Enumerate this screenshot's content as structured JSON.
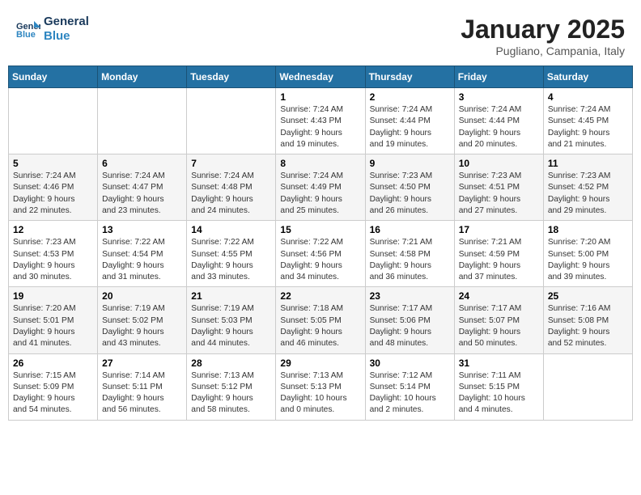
{
  "logo": {
    "line1": "General",
    "line2": "Blue"
  },
  "header": {
    "month": "January 2025",
    "location": "Pugliano, Campania, Italy"
  },
  "days_of_week": [
    "Sunday",
    "Monday",
    "Tuesday",
    "Wednesday",
    "Thursday",
    "Friday",
    "Saturday"
  ],
  "weeks": [
    [
      {
        "day": "",
        "info": ""
      },
      {
        "day": "",
        "info": ""
      },
      {
        "day": "",
        "info": ""
      },
      {
        "day": "1",
        "info": "Sunrise: 7:24 AM\nSunset: 4:43 PM\nDaylight: 9 hours\nand 19 minutes."
      },
      {
        "day": "2",
        "info": "Sunrise: 7:24 AM\nSunset: 4:44 PM\nDaylight: 9 hours\nand 19 minutes."
      },
      {
        "day": "3",
        "info": "Sunrise: 7:24 AM\nSunset: 4:44 PM\nDaylight: 9 hours\nand 20 minutes."
      },
      {
        "day": "4",
        "info": "Sunrise: 7:24 AM\nSunset: 4:45 PM\nDaylight: 9 hours\nand 21 minutes."
      }
    ],
    [
      {
        "day": "5",
        "info": "Sunrise: 7:24 AM\nSunset: 4:46 PM\nDaylight: 9 hours\nand 22 minutes."
      },
      {
        "day": "6",
        "info": "Sunrise: 7:24 AM\nSunset: 4:47 PM\nDaylight: 9 hours\nand 23 minutes."
      },
      {
        "day": "7",
        "info": "Sunrise: 7:24 AM\nSunset: 4:48 PM\nDaylight: 9 hours\nand 24 minutes."
      },
      {
        "day": "8",
        "info": "Sunrise: 7:24 AM\nSunset: 4:49 PM\nDaylight: 9 hours\nand 25 minutes."
      },
      {
        "day": "9",
        "info": "Sunrise: 7:23 AM\nSunset: 4:50 PM\nDaylight: 9 hours\nand 26 minutes."
      },
      {
        "day": "10",
        "info": "Sunrise: 7:23 AM\nSunset: 4:51 PM\nDaylight: 9 hours\nand 27 minutes."
      },
      {
        "day": "11",
        "info": "Sunrise: 7:23 AM\nSunset: 4:52 PM\nDaylight: 9 hours\nand 29 minutes."
      }
    ],
    [
      {
        "day": "12",
        "info": "Sunrise: 7:23 AM\nSunset: 4:53 PM\nDaylight: 9 hours\nand 30 minutes."
      },
      {
        "day": "13",
        "info": "Sunrise: 7:22 AM\nSunset: 4:54 PM\nDaylight: 9 hours\nand 31 minutes."
      },
      {
        "day": "14",
        "info": "Sunrise: 7:22 AM\nSunset: 4:55 PM\nDaylight: 9 hours\nand 33 minutes."
      },
      {
        "day": "15",
        "info": "Sunrise: 7:22 AM\nSunset: 4:56 PM\nDaylight: 9 hours\nand 34 minutes."
      },
      {
        "day": "16",
        "info": "Sunrise: 7:21 AM\nSunset: 4:58 PM\nDaylight: 9 hours\nand 36 minutes."
      },
      {
        "day": "17",
        "info": "Sunrise: 7:21 AM\nSunset: 4:59 PM\nDaylight: 9 hours\nand 37 minutes."
      },
      {
        "day": "18",
        "info": "Sunrise: 7:20 AM\nSunset: 5:00 PM\nDaylight: 9 hours\nand 39 minutes."
      }
    ],
    [
      {
        "day": "19",
        "info": "Sunrise: 7:20 AM\nSunset: 5:01 PM\nDaylight: 9 hours\nand 41 minutes."
      },
      {
        "day": "20",
        "info": "Sunrise: 7:19 AM\nSunset: 5:02 PM\nDaylight: 9 hours\nand 43 minutes."
      },
      {
        "day": "21",
        "info": "Sunrise: 7:19 AM\nSunset: 5:03 PM\nDaylight: 9 hours\nand 44 minutes."
      },
      {
        "day": "22",
        "info": "Sunrise: 7:18 AM\nSunset: 5:05 PM\nDaylight: 9 hours\nand 46 minutes."
      },
      {
        "day": "23",
        "info": "Sunrise: 7:17 AM\nSunset: 5:06 PM\nDaylight: 9 hours\nand 48 minutes."
      },
      {
        "day": "24",
        "info": "Sunrise: 7:17 AM\nSunset: 5:07 PM\nDaylight: 9 hours\nand 50 minutes."
      },
      {
        "day": "25",
        "info": "Sunrise: 7:16 AM\nSunset: 5:08 PM\nDaylight: 9 hours\nand 52 minutes."
      }
    ],
    [
      {
        "day": "26",
        "info": "Sunrise: 7:15 AM\nSunset: 5:09 PM\nDaylight: 9 hours\nand 54 minutes."
      },
      {
        "day": "27",
        "info": "Sunrise: 7:14 AM\nSunset: 5:11 PM\nDaylight: 9 hours\nand 56 minutes."
      },
      {
        "day": "28",
        "info": "Sunrise: 7:13 AM\nSunset: 5:12 PM\nDaylight: 9 hours\nand 58 minutes."
      },
      {
        "day": "29",
        "info": "Sunrise: 7:13 AM\nSunset: 5:13 PM\nDaylight: 10 hours\nand 0 minutes."
      },
      {
        "day": "30",
        "info": "Sunrise: 7:12 AM\nSunset: 5:14 PM\nDaylight: 10 hours\nand 2 minutes."
      },
      {
        "day": "31",
        "info": "Sunrise: 7:11 AM\nSunset: 5:15 PM\nDaylight: 10 hours\nand 4 minutes."
      },
      {
        "day": "",
        "info": ""
      }
    ]
  ]
}
